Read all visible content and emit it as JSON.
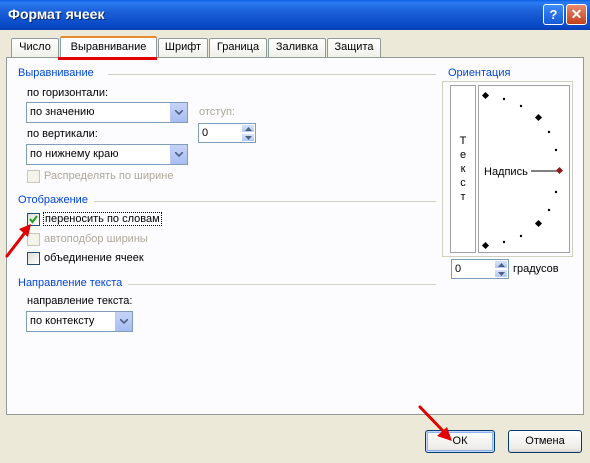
{
  "window": {
    "title": "Формат ячеек",
    "help_label": "?",
    "close_label": "✕"
  },
  "tabs": [
    "Число",
    "Выравнивание",
    "Шрифт",
    "Граница",
    "Заливка",
    "Защита"
  ],
  "alignment": {
    "group_label": "Выравнивание",
    "horizontal_label": "по горизонтали:",
    "horizontal_value": "по значению",
    "indent_label": "отступ:",
    "indent_value": "0",
    "vertical_label": "по вертикали:",
    "vertical_value": "по нижнему краю",
    "distribute_label": "Распределять по ширине"
  },
  "display": {
    "group_label": "Отображение",
    "wrap_label": "переносить по словам",
    "wrap_checked": true,
    "shrink_label": "автоподбор ширины",
    "merge_label": "объединение ячеек"
  },
  "direction": {
    "group_label": "Направление текста",
    "label": "направление текста:",
    "value": "по контексту"
  },
  "orientation": {
    "group_label": "Ориентация",
    "vertical_text": [
      "Т",
      "е",
      "к",
      "с",
      "т"
    ],
    "dial_label": "Надпись",
    "degrees_value": "0",
    "degrees_label": "градусов"
  },
  "buttons": {
    "ok": "ОК",
    "cancel": "Отмена"
  },
  "colors": {
    "annotation": "#E10000",
    "group_label": "#0046D5",
    "titlebar": "#0A5FE6"
  }
}
